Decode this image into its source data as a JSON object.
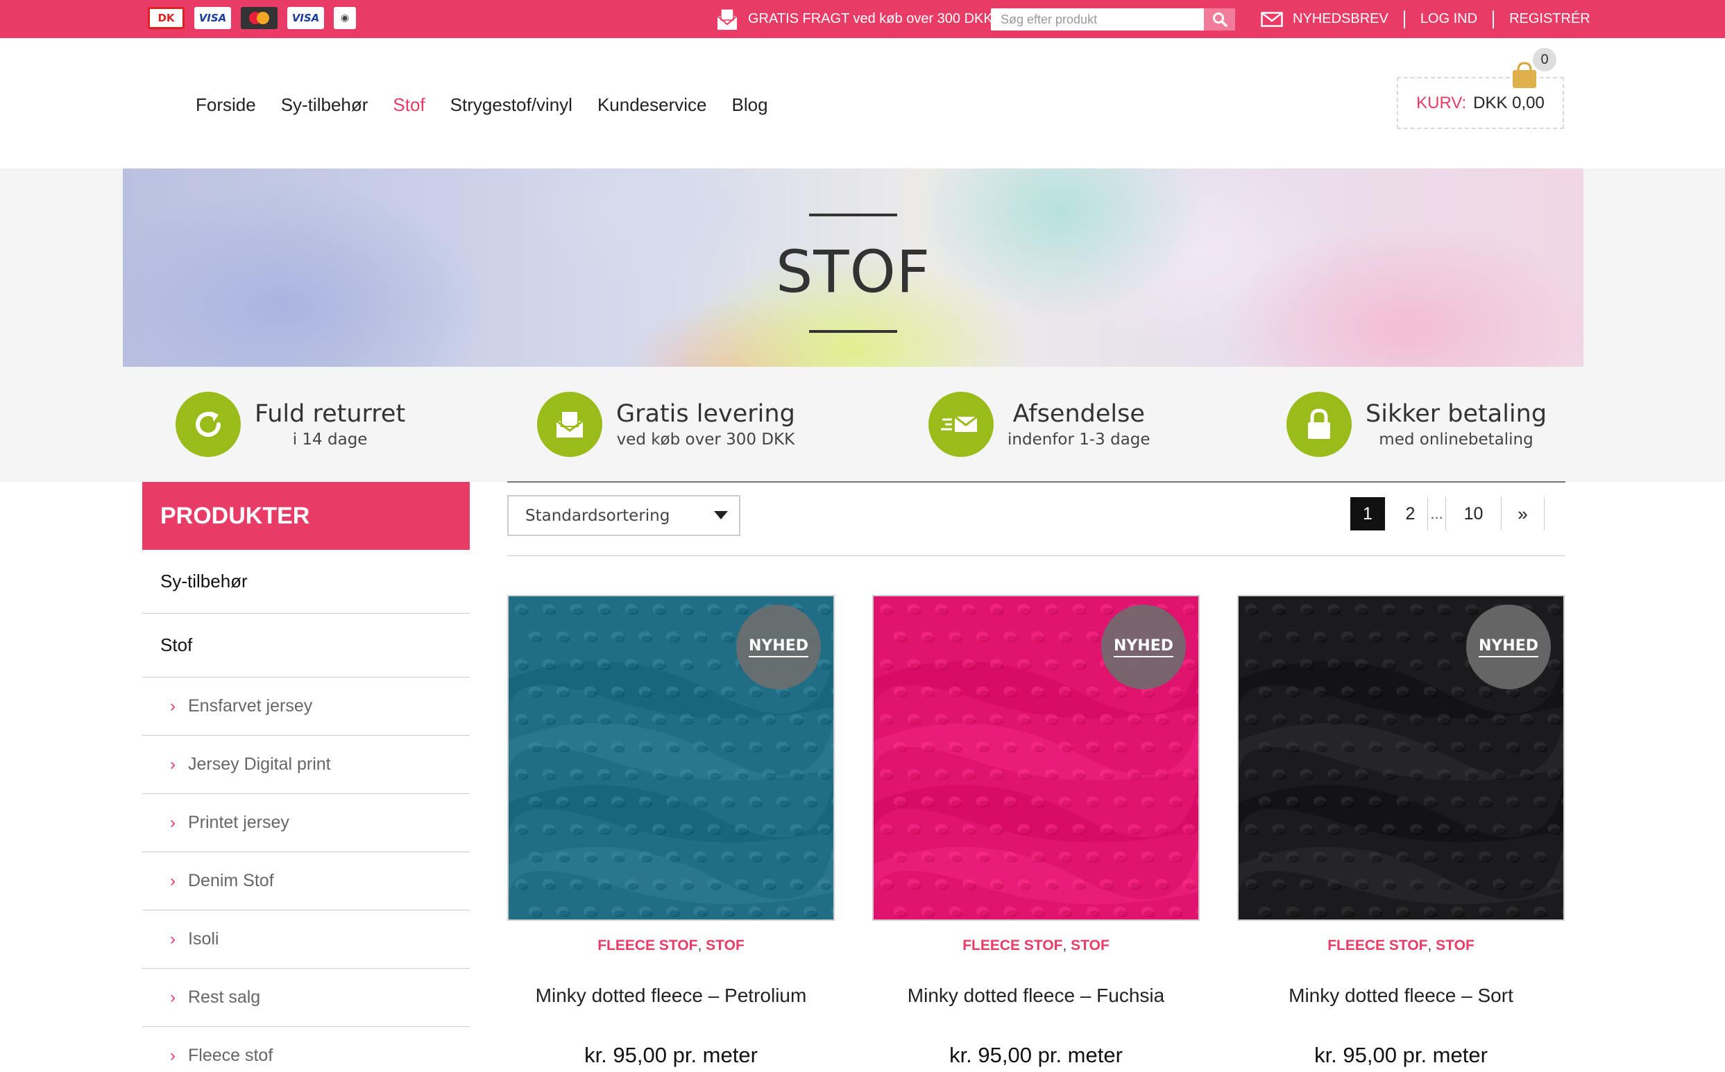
{
  "topbar": {
    "cards": [
      "DK",
      "VISA",
      "VISA"
    ],
    "freight_text": "GRATIS FRAGT ved køb over 300 DKK",
    "search_placeholder": "Søg efter produkt",
    "links": [
      "NYHEDSBREV",
      "LOG IND",
      "REGISTRÉR"
    ],
    "accent_color": "#e83c67"
  },
  "nav": {
    "items": [
      "Forside",
      "Sy-tilbehør",
      "Stof",
      "Strygestof/vinyl",
      "Kundeservice",
      "Blog"
    ],
    "active": "Stof"
  },
  "cart": {
    "label": "KURV:",
    "amount": "DKK 0,00",
    "count": "0"
  },
  "hero": {
    "title": "STOF"
  },
  "features": [
    {
      "icon": "return-icon",
      "title": "Fuld returret",
      "subtitle": "i 14 dage"
    },
    {
      "icon": "envelope-icon",
      "title": "Gratis levering",
      "subtitle": "ved køb over 300 DKK"
    },
    {
      "icon": "fast-mail-icon",
      "title": "Afsendelse",
      "subtitle": "indenfor 1-3 dage"
    },
    {
      "icon": "lock-icon",
      "title": "Sikker betaling",
      "subtitle": "med onlinebetaling"
    }
  ],
  "sidebar": {
    "heading": "PRODUKTER",
    "categories": [
      "Sy-tilbehør",
      "Stof"
    ],
    "subcategories": [
      "Ensfarvet jersey",
      "Jersey Digital print",
      "Printet jersey",
      "Denim Stof",
      "Isoli",
      "Rest salg",
      "Fleece stof"
    ]
  },
  "toolbar": {
    "sort_value": "Standardsortering",
    "pages": [
      "1",
      "2",
      "...",
      "10",
      "»"
    ],
    "current_page": "1"
  },
  "products": [
    {
      "badge": "NYHED",
      "cat1": "FLEECE STOF",
      "cat2": "STOF",
      "name": "Minky dotted fleece – Petrolium",
      "price": "kr. 95,00 pr. meter",
      "color": "#1f6e86"
    },
    {
      "badge": "NYHED",
      "cat1": "FLEECE STOF",
      "cat2": "STOF",
      "name": "Minky dotted fleece – Fuchsia",
      "price": "kr. 95,00 pr. meter",
      "color": "#e0136f"
    },
    {
      "badge": "NYHED",
      "cat1": "FLEECE STOF",
      "cat2": "STOF",
      "name": "Minky dotted fleece – Sort",
      "price": "kr. 95,00 pr. meter",
      "color": "#1b1b1d"
    }
  ],
  "feature_color": "#99bc1a"
}
